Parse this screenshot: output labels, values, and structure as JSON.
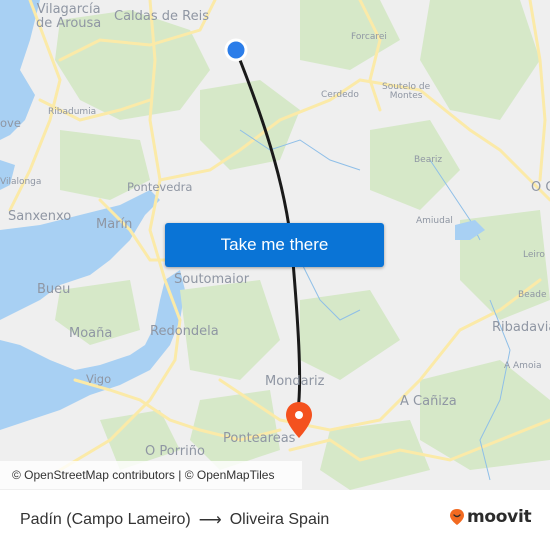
{
  "map": {
    "attribution": "© OpenStreetMap contributors | © OpenMapTiles",
    "colors": {
      "land": "#efefef",
      "water": "#a8d0f3",
      "forest": "#d6e8c8",
      "road": "#fbeaa8",
      "route_line": "#1a1a1a",
      "origin_marker": "#2b7de9",
      "destination_marker": "#f4511e"
    },
    "places": [
      {
        "id": "vilagarcia",
        "name": "Vilagarcía\nde Arousa",
        "size": "big"
      },
      {
        "id": "caldas",
        "name": "Caldas de Reis",
        "size": "big"
      },
      {
        "id": "forcarei",
        "name": "Forcarei",
        "size": "small"
      },
      {
        "id": "cerdedo",
        "name": "Cerdedo",
        "size": "small"
      },
      {
        "id": "soutelo",
        "name": "Soutelo de\nMontes",
        "size": "small"
      },
      {
        "id": "ribadumia",
        "name": "Ribadumia",
        "size": "small"
      },
      {
        "id": "ove",
        "name": "ove",
        "size": "mid"
      },
      {
        "id": "vilalonga",
        "name": "Vilalonga",
        "size": "small"
      },
      {
        "id": "pontevedra",
        "name": "Pontevedra",
        "size": "mid"
      },
      {
        "id": "sanxenxo",
        "name": "Sanxenxo",
        "size": "big"
      },
      {
        "id": "marin",
        "name": "Marín",
        "size": "big"
      },
      {
        "id": "beariz",
        "name": "Beariz",
        "size": "small"
      },
      {
        "id": "amiudal",
        "name": "Amiudal",
        "size": "small"
      },
      {
        "id": "ocarballino",
        "name": "O C",
        "size": "big"
      },
      {
        "id": "leiro",
        "name": "Leiro",
        "size": "small"
      },
      {
        "id": "beade",
        "name": "Beade",
        "size": "small"
      },
      {
        "id": "soutomaior",
        "name": "Soutomaior",
        "size": "big"
      },
      {
        "id": "bueu",
        "name": "Bueu",
        "size": "big"
      },
      {
        "id": "moana",
        "name": "Moaña",
        "size": "big"
      },
      {
        "id": "redondela",
        "name": "Redondela",
        "size": "big"
      },
      {
        "id": "ribadavia",
        "name": "Ribadavia",
        "size": "big"
      },
      {
        "id": "aamoia",
        "name": "A Amoia",
        "size": "small"
      },
      {
        "id": "vigo",
        "name": "Vigo",
        "size": "mid"
      },
      {
        "id": "mondariz",
        "name": "Mondariz",
        "size": "big"
      },
      {
        "id": "acaniza",
        "name": "A Cañiza",
        "size": "big"
      },
      {
        "id": "ponteareas",
        "name": "Ponteareas",
        "size": "big"
      },
      {
        "id": "oporrino",
        "name": "O Porriño",
        "size": "big"
      }
    ]
  },
  "cta": {
    "label": "Take me there"
  },
  "route": {
    "origin": "Padín (Campo Lameiro)",
    "arrow": "⟶",
    "destination": "Oliveira Spain"
  },
  "brand": {
    "name": "moovit",
    "color": "#f26a21"
  }
}
